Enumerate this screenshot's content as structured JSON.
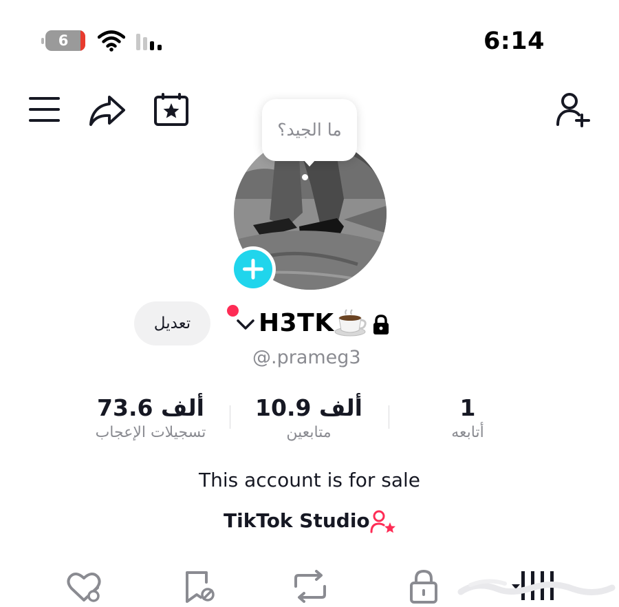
{
  "status_bar": {
    "battery_level": "6",
    "time": "6:14"
  },
  "tooltip": {
    "text": "ما الجيد؟"
  },
  "profile": {
    "username": "H3TK",
    "handle": "@.prameg3",
    "edit_label": "تعديل",
    "bio": "This account is for sale",
    "studio_label": "TikTok Studio"
  },
  "stats": [
    {
      "value": "73.6 ألف",
      "label": "تسجيلات الإعجاب"
    },
    {
      "value": "10.9 ألف",
      "label": "متابعين"
    },
    {
      "value": "1",
      "label": "أتابعه"
    }
  ],
  "icons": {
    "menu": "menu-icon",
    "share": "share-icon",
    "calendar": "calendar-star-icon",
    "add_user": "add-friend-icon",
    "tabs": [
      "liked-hidden-icon",
      "favorites-hidden-icon",
      "repost-icon",
      "private-lock-icon",
      "videos-grid-icon"
    ]
  },
  "colors": {
    "accent_pink": "#fe2c55",
    "add_button_cyan": "#20d5ec",
    "secondary_text": "#8a8b91"
  }
}
